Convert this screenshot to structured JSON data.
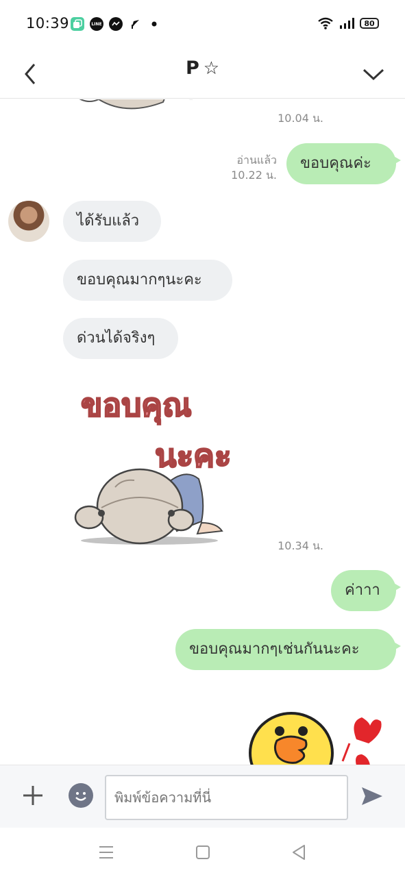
{
  "status_bar": {
    "time": "10:39",
    "battery": "80",
    "app_icons": [
      "copy-app-icon",
      "line-icon",
      "messenger-icon",
      "location-arrow-icon",
      "dot-icon"
    ]
  },
  "header": {
    "title": "P",
    "star": "☆",
    "back_icon": "chevron-left-icon",
    "expand_icon": "chevron-down-icon"
  },
  "messages": [
    {
      "type": "time",
      "side": "in",
      "time": "10.04 น."
    },
    {
      "type": "text",
      "side": "out",
      "text": "ขอบคุณค่ะ",
      "read": "อ่านแล้ว",
      "time": "10.22 น."
    },
    {
      "type": "text",
      "side": "in",
      "text": "ได้รับแล้ว"
    },
    {
      "type": "text",
      "side": "in",
      "text": "ขอบคุณมากๆนะคะ"
    },
    {
      "type": "text",
      "side": "in",
      "text": "ด่วนได้จริงๆ"
    },
    {
      "type": "sticker",
      "side": "in",
      "sticker_text_1": "ขอบคุณ",
      "sticker_text_2": "นะคะ",
      "time": "10.34 น."
    },
    {
      "type": "text",
      "side": "out",
      "text": "ค่าาา"
    },
    {
      "type": "text",
      "side": "out",
      "text": "ขอบคุณมากๆเช่นกันนะคะ"
    },
    {
      "type": "sticker",
      "side": "out",
      "sticker": "chick-with-hearts"
    }
  ],
  "input_bar": {
    "placeholder": "พิมพ์ข้อความที่นี่"
  },
  "colors": {
    "out_bubble": "#b9ecb5",
    "in_bubble": "#eef0f2",
    "timestamp": "#8a8a8a"
  }
}
